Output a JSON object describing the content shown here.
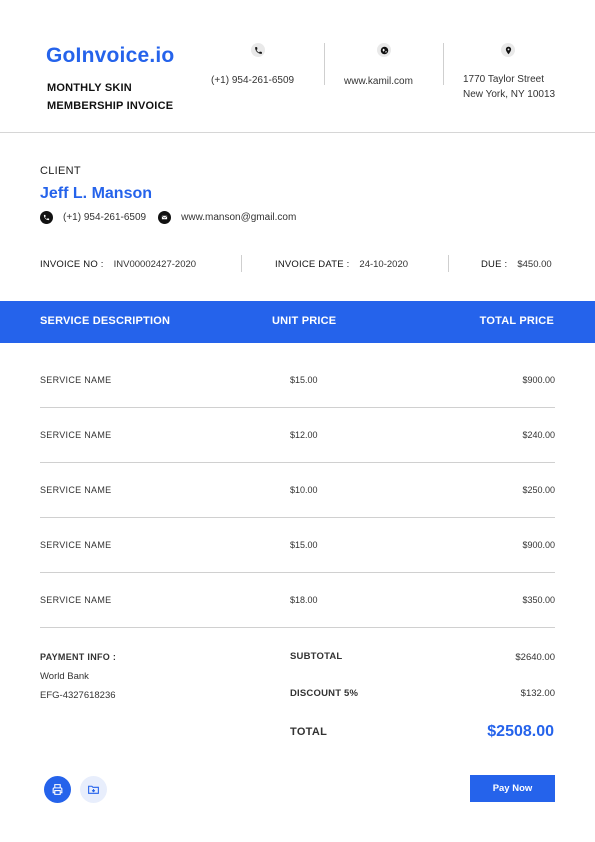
{
  "header": {
    "brand": "GoInvoice.io",
    "subtitle": "MONTHLY SKIN MEMBERSHIP INVOICE",
    "phone": "(+1) 954-261-6509",
    "website": "www.kamil.com",
    "address_line1": "1770 Taylor Street",
    "address_line2": "New York, NY 10013",
    "icons": [
      "phone-icon",
      "globe-icon",
      "location-pin-icon"
    ]
  },
  "client": {
    "label": "CLIENT",
    "name": "Jeff L. Manson",
    "phone": "(+1) 954-261-6509",
    "email": "www.manson@gmail.com"
  },
  "invoice": {
    "no_label": "INVOICE NO :",
    "no": "INV00002427-2020",
    "date_label": "INVOICE DATE :",
    "date": "24-10-2020",
    "due_label": "DUE :",
    "due": "$450.00"
  },
  "table": {
    "headers": [
      "SERVICE DESCRIPTION",
      "UNIT PRICE",
      "TOTAL PRICE"
    ],
    "rows": [
      {
        "name": "SERVICE NAME",
        "unit": "$15.00",
        "total": "$900.00"
      },
      {
        "name": "SERVICE NAME",
        "unit": "$12.00",
        "total": "$240.00"
      },
      {
        "name": "SERVICE NAME",
        "unit": "$10.00",
        "total": "$250.00"
      },
      {
        "name": "SERVICE NAME",
        "unit": "$15.00",
        "total": "$900.00"
      },
      {
        "name": "SERVICE NAME",
        "unit": "$18.00",
        "total": "$350.00"
      }
    ]
  },
  "payment": {
    "title": "PAYMENT INFO :",
    "bank": "World Bank",
    "account": "EFG-4327618236"
  },
  "summary": {
    "subtotal_label": "SUBTOTAL",
    "subtotal": "$2640.00",
    "discount_label": "DISCOUNT 5%",
    "discount": "$132.00",
    "total_label": "TOTAL",
    "total": "$2508.00"
  },
  "footer": {
    "pay_button": "Pay Now",
    "print_icon": "printer-icon",
    "download_icon": "download-folder-icon"
  },
  "colors": {
    "accent": "#2563eb",
    "icon_bg_light": "#e8eefc"
  }
}
